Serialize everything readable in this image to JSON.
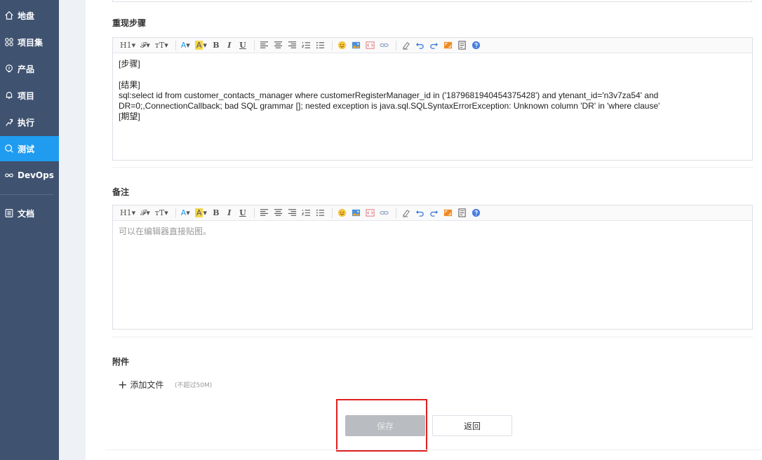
{
  "sidebar": {
    "items": [
      {
        "label": "地盘",
        "icon": "home-icon"
      },
      {
        "label": "项目集",
        "icon": "grid-icon"
      },
      {
        "label": "产品",
        "icon": "bulb-icon"
      },
      {
        "label": "项目",
        "icon": "bell-icon"
      },
      {
        "label": "执行",
        "icon": "run-icon"
      },
      {
        "label": "测试",
        "icon": "search-icon"
      },
      {
        "label": "DevOps",
        "icon": "infinity-icon"
      },
      {
        "label": "文档",
        "icon": "document-icon"
      }
    ],
    "active": "测试"
  },
  "steps": {
    "title": "重现步骤",
    "lines": [
      "[步骤]",
      "",
      "[结果]",
      "sql:select id from customer_contacts_manager where customerRegisterManager_id in ('1879681940454375428') and ytenant_id='n3v7za54' and",
      "DR=0;,ConnectionCallback; bad SQL grammar []; nested exception is java.sql.SQLSyntaxErrorException: Unknown column 'DR' in 'where clause'",
      "[期望]"
    ]
  },
  "notes": {
    "title": "备注",
    "placeholder": "可以在编辑器直接贴图。"
  },
  "toolbar": {
    "heading": "H1",
    "font": "𝓕",
    "size": "тT",
    "color": "A",
    "highlight": "A",
    "bold": "B",
    "italic": "I",
    "underline": "U",
    "caret": "▾"
  },
  "attachments": {
    "title": "附件",
    "add_label": "添加文件",
    "limit": "(不超过50M)"
  },
  "actions": {
    "save": "保存",
    "back": "返回"
  },
  "colors": {
    "sidebar_bg": "#3f5270",
    "active": "#1f9cf0",
    "highlight_box": "#e02020"
  }
}
